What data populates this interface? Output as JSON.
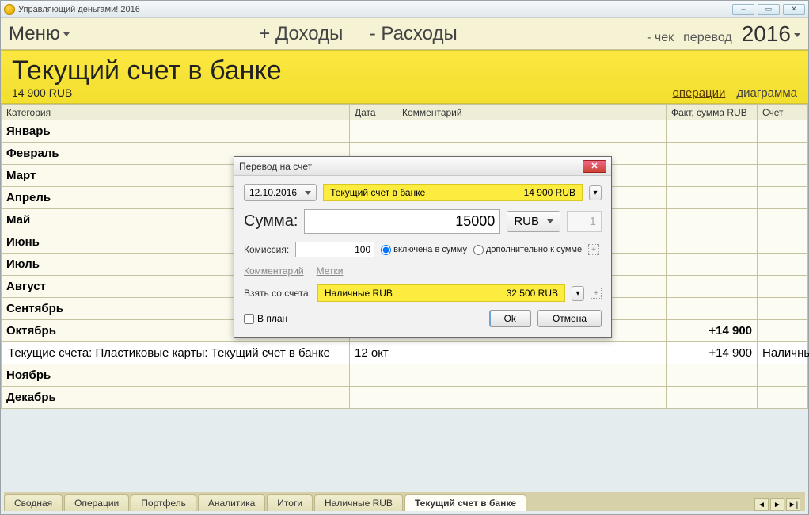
{
  "window": {
    "title": "Управляющий деньгами! 2016"
  },
  "cmdbar": {
    "menu": "Меню",
    "income": "+ Доходы",
    "expense": "- Расходы",
    "cheque": "- чек",
    "transfer": "перевод",
    "year": "2016"
  },
  "account": {
    "name": "Текущий счет в банке",
    "balance": "14 900 RUB",
    "tab_ops": "операции",
    "tab_chart": "диаграмма"
  },
  "grid": {
    "headers": {
      "category": "Категория",
      "date": "Дата",
      "comment": "Комментарий",
      "fact": "Факт, сумма RUB",
      "acct": "Счет"
    },
    "months": [
      "Январь",
      "Февраль",
      "Март",
      "Апрель",
      "Май",
      "Июнь",
      "Июль",
      "Август",
      "Сентябрь",
      "Октябрь",
      "Ноябрь",
      "Декабрь"
    ],
    "oct_amount": "+14 900",
    "detail": {
      "cat": "Текущие счета: Пластиковые карты: Текущий счет в банке",
      "date": "12 окт",
      "amount": "+14 900",
      "acct": "Наличные"
    }
  },
  "tabs": [
    "Сводная",
    "Операции",
    "Портфель",
    "Аналитика",
    "Итоги",
    "Наличные RUB",
    "Текущий счет в банке"
  ],
  "dialog": {
    "title": "Перевод на счет",
    "date": "12.10.2016",
    "to_account": "Текущий счет в банке",
    "to_balance": "14 900 RUB",
    "sum_label": "Сумма:",
    "sum_value": "15000",
    "currency": "RUB",
    "qty": "1",
    "commission_label": "Комиссия:",
    "commission_value": "100",
    "radio_incl": "включена в сумму",
    "radio_extra": "дополнительно к сумме",
    "link_comment": "Комментарий",
    "link_tags": "Метки",
    "from_label": "Взять со счета:",
    "from_account": "Наличные RUB",
    "from_balance": "32 500 RUB",
    "plan_check": "В план",
    "ok": "Ok",
    "cancel": "Отмена"
  }
}
